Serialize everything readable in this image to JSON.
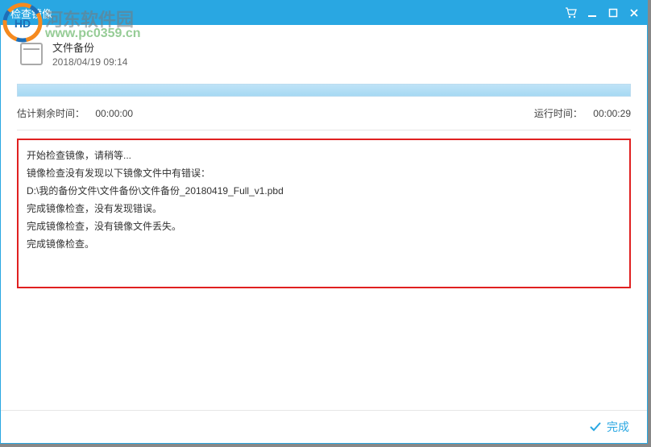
{
  "titlebar": {
    "title": "检查镜像"
  },
  "watermark": {
    "site_name": "河东软件园",
    "site_url": "www.pc0359.cn"
  },
  "task": {
    "name": "文件备份",
    "datetime": "2018/04/19 09:14"
  },
  "progress": {
    "percent": 100
  },
  "time_labels": {
    "remaining_label": "估计剩余时间：",
    "remaining_value": "00:00:00",
    "elapsed_label": "运行时间：",
    "elapsed_value": "00:00:29"
  },
  "log_lines": [
    "开始检查镜像，请稍等...",
    "镜像检查没有发现以下镜像文件中有错误：",
    "D:\\我的备份文件\\文件备份\\文件备份_20180419_Full_v1.pbd",
    "完成镜像检查，没有发现错误。",
    "完成镜像检查，没有镜像文件丢失。",
    "完成镜像检查。"
  ],
  "footer": {
    "done_label": "完成"
  },
  "colors": {
    "accent": "#29a7e2",
    "highlight_border": "#e02020"
  }
}
